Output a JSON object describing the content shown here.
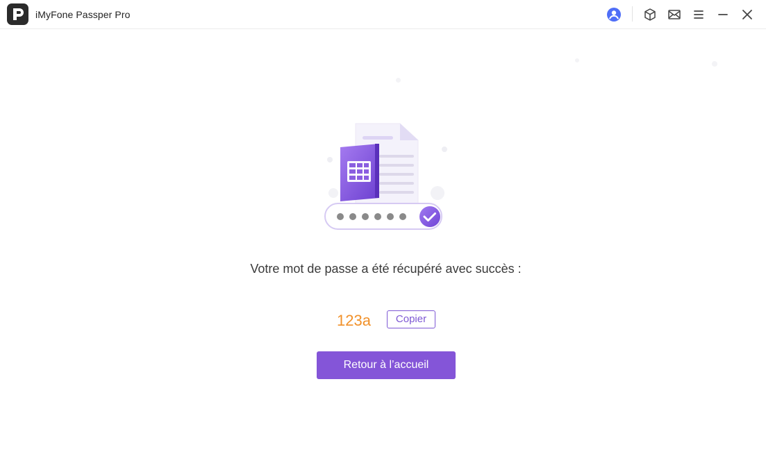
{
  "window": {
    "title": "iMyFone Passper Pro",
    "icons": [
      "user-account-icon",
      "cube-icon",
      "mail-icon",
      "menu-icon",
      "minimize-icon",
      "close-icon"
    ],
    "accent": "#4f6ef7"
  },
  "main": {
    "message": "Votre mot de passe a été récupéré avec succès :",
    "password": "123a",
    "copy_label": "Copier",
    "home_label": "Retour à l’accueil",
    "password_color": "#f1912a",
    "brand_color": "#8455d8"
  }
}
